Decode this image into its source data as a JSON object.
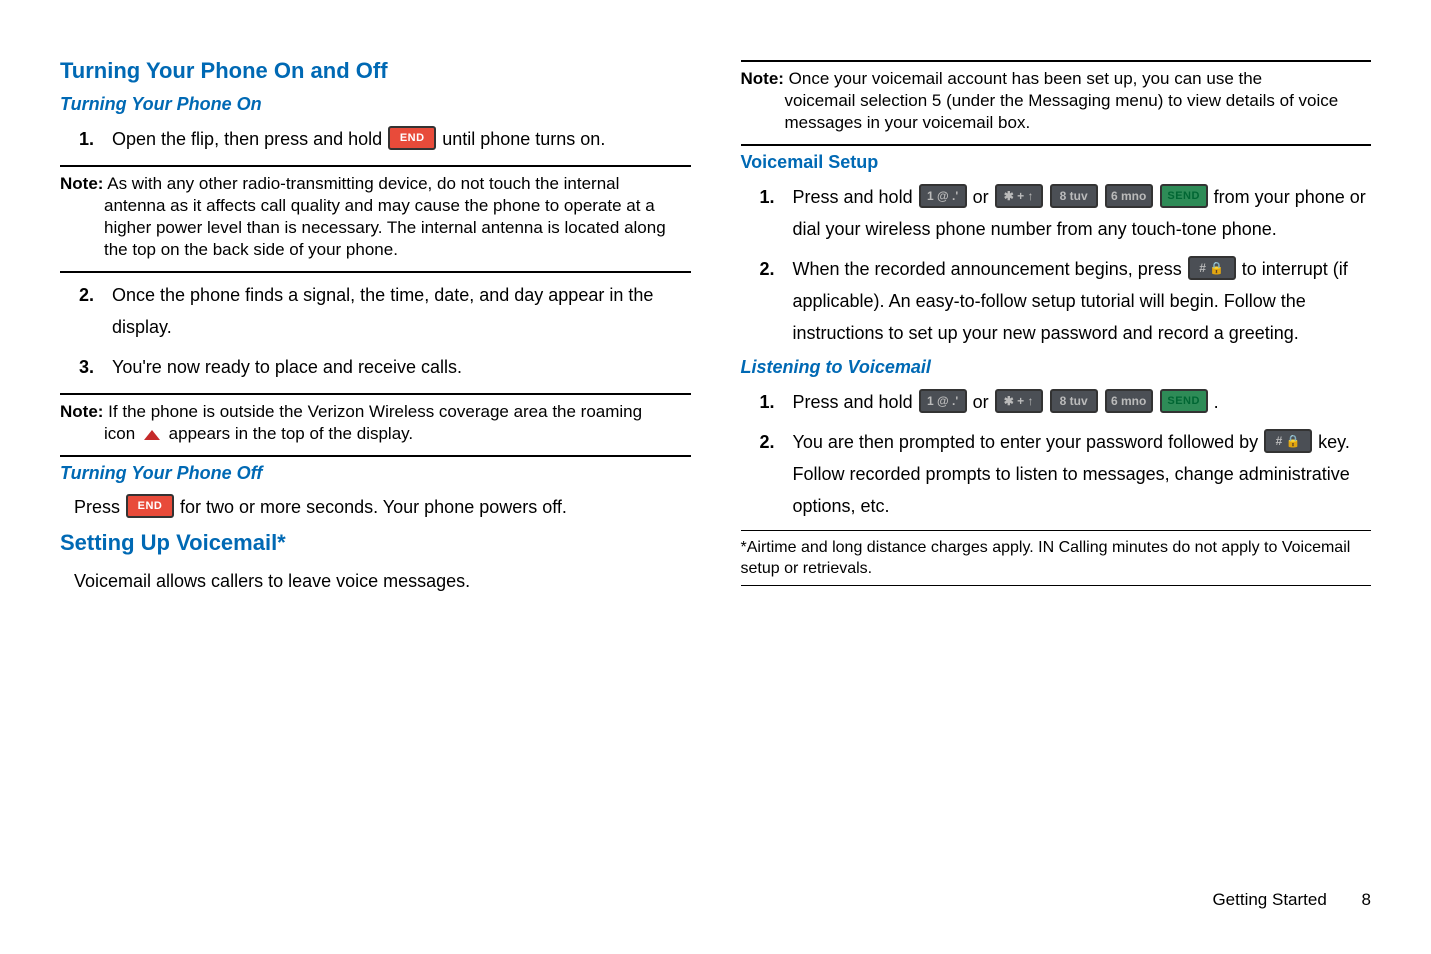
{
  "left": {
    "h1": "Turning Your Phone On and Off",
    "h2a": "Turning Your Phone On",
    "steps_a": [
      {
        "n": "1.",
        "pre": "Open the flip, then press and hold ",
        "key": "END",
        "post": " until phone turns on."
      },
      {
        "n": "2.",
        "text": "Once the phone finds a signal, the time, date, and day appear in the display."
      },
      {
        "n": "3.",
        "text": "You're now ready to place and receive calls."
      }
    ],
    "note1_label": "Note:",
    "note1_first": " As with any other radio-transmitting device, do not touch the internal",
    "note1_rest": "antenna as it affects call quality and may cause the phone to operate at a higher power level than is necessary. The internal antenna is located along the top on the back side of your phone.",
    "note2_label": "Note:",
    "note2_first": " If the phone is outside the Verizon Wireless coverage area the roaming",
    "note2_rest_pre": "icon ",
    "note2_rest_post": " appears in the top of the display.",
    "h2b": "Turning Your Phone Off",
    "off_pre": "Press ",
    "off_key": "END",
    "off_post": " for two or more seconds. Your phone powers off.",
    "h1b": "Setting Up Voicemail*",
    "vm_intro": "Voicemail allows callers to leave voice messages."
  },
  "right": {
    "note_label": "Note:",
    "note_first": " Once your voicemail account has been set up, you can use the",
    "note_rest": "voicemail selection 5 (under the Messaging menu) to view details of voice messages in your voicemail box.",
    "h2a": "Voicemail Setup",
    "setup": [
      {
        "n": "1.",
        "pre": "Press and hold ",
        "keys1": [
          "1 @ .'"
        ],
        "mid": " or ",
        "keys2": [
          "✱ + ↑",
          "8 tuv",
          "6 mno",
          "SEND"
        ],
        "post": " from your phone or dial your wireless phone number from any touch-tone phone."
      },
      {
        "n": "2.",
        "pre": "When the recorded announcement begins, press ",
        "key": "# 🔒",
        "post": " to interrupt (if applicable). An easy-to-follow setup tutorial will begin. Follow the instructions to set up your new password and record a greeting."
      }
    ],
    "h2b": "Listening to Voicemail",
    "listen": [
      {
        "n": "1.",
        "pre": "Press and hold ",
        "keys1": [
          "1 @ .'"
        ],
        "mid": " or ",
        "keys2": [
          "✱ + ↑",
          "8 tuv",
          "6 mno",
          "SEND"
        ],
        "post": " ."
      },
      {
        "n": "2.",
        "pre": "You are then prompted to enter your password followed by ",
        "key": "# 🔒",
        "post": " key. Follow recorded prompts to listen to messages, change administrative options, etc."
      }
    ],
    "footnote": " *Airtime and long distance charges apply. IN Calling minutes do not apply to Voicemail setup or retrievals."
  },
  "footer": {
    "section": "Getting Started",
    "page": "8"
  }
}
